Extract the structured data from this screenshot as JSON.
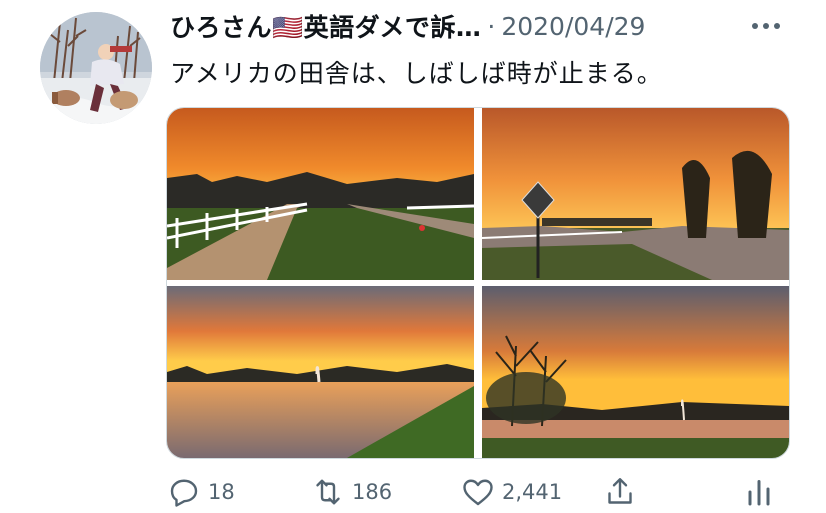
{
  "tweet": {
    "author_name": "ひろさん🇺🇸英語ダメで訴…",
    "separator": "·",
    "date": "2020/04/29",
    "text": "アメリカの田舎は、しばしば時が止まる。"
  },
  "media": {
    "photos": [
      {
        "subject": "sunset over road with white fence"
      },
      {
        "subject": "sunset over intersection with road sign"
      },
      {
        "subject": "sunset over pond with fountain"
      },
      {
        "subject": "sunset over pond with trees and fountain"
      }
    ]
  },
  "actions": {
    "reply_count": "18",
    "retweet_count": "186",
    "like_count": "2,441"
  },
  "colors": {
    "secondary_text": "#536471",
    "sky_orange": "#f08a2b",
    "sky_glow": "#ffc54a"
  }
}
